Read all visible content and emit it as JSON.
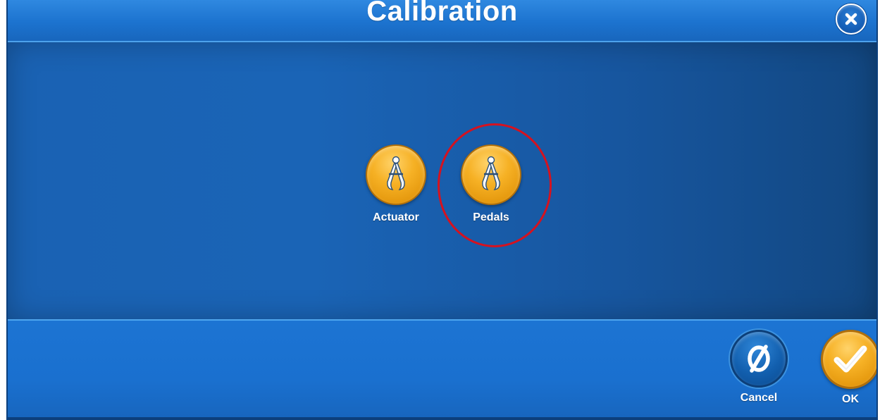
{
  "window": {
    "title": "Calibration"
  },
  "titlebar": {
    "close_icon": "close-x-icon"
  },
  "tools": [
    {
      "label": "Actuator",
      "icon": "caliper-icon"
    },
    {
      "label": "Pedals",
      "icon": "caliper-icon",
      "highlighted": true
    }
  ],
  "footer": {
    "cancel_label": "Cancel",
    "ok_label": "OK",
    "cancel_icon": "cancel-circle-slash-icon",
    "ok_icon": "checkmark-icon"
  },
  "colors": {
    "accent_blue": "#1a6cc8",
    "button_orange": "#f6b125",
    "highlight_red": "#d6121f"
  }
}
